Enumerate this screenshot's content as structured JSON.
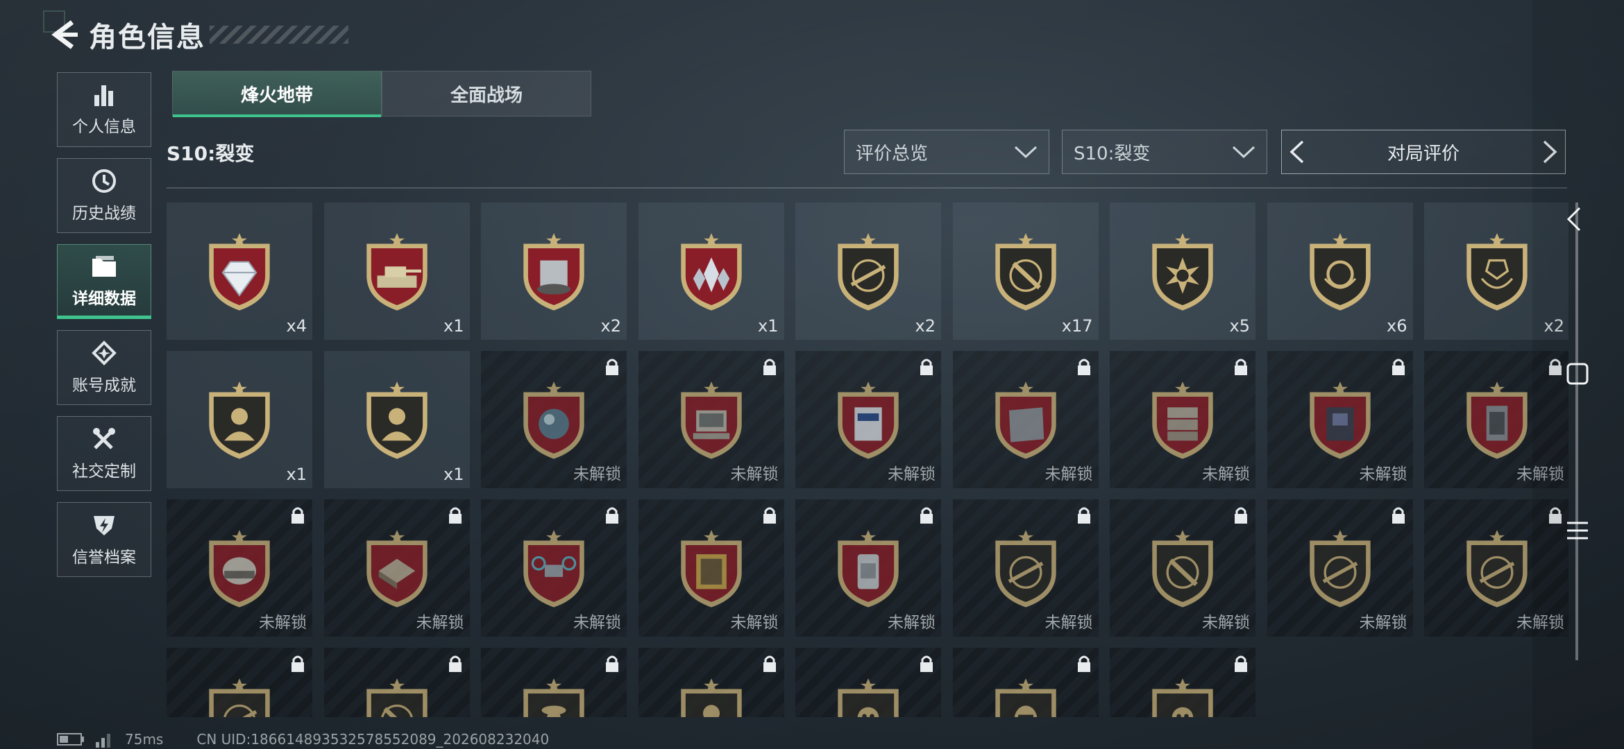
{
  "header": {
    "title": "角色信息"
  },
  "sidebar": {
    "items": [
      {
        "label": "个人信息",
        "icon": "bar-chart-icon"
      },
      {
        "label": "历史战绩",
        "icon": "history-icon"
      },
      {
        "label": "详细数据",
        "icon": "folder-icon",
        "active": true
      },
      {
        "label": "账号成就",
        "icon": "medal-icon"
      },
      {
        "label": "社交定制",
        "icon": "tools-icon"
      },
      {
        "label": "信誉档案",
        "icon": "shield-bolt-icon"
      }
    ]
  },
  "tabs": [
    {
      "label": "烽火地带",
      "active": true
    },
    {
      "label": "全面战场",
      "active": false
    }
  ],
  "season_label": "S10:裂变",
  "filters": {
    "overview": "评价总览",
    "season": "S10:裂变",
    "pager": "对局评价"
  },
  "badges": [
    {
      "emblem": "diamond",
      "count": "x4",
      "locked": false
    },
    {
      "emblem": "tank",
      "count": "x1",
      "locked": false
    },
    {
      "emblem": "robot-vacuum",
      "count": "x2",
      "locked": false
    },
    {
      "emblem": "crystal-cluster",
      "count": "x1",
      "locked": false
    },
    {
      "emblem": "rifle-target",
      "count": "x2",
      "locked": false
    },
    {
      "emblem": "knife-target",
      "count": "x17",
      "locked": false
    },
    {
      "emblem": "burst-skull",
      "count": "x5",
      "locked": false
    },
    {
      "emblem": "laurel-emblem",
      "count": "x6",
      "locked": false
    },
    {
      "emblem": "laurel-shield",
      "count": "x2",
      "locked": false
    },
    {
      "emblem": "operator-bust",
      "count": "x1",
      "locked": false
    },
    {
      "emblem": "operator-bust",
      "count": "x1",
      "locked": false
    },
    {
      "emblem": "orb",
      "count": "未解锁",
      "locked": true
    },
    {
      "emblem": "computer",
      "count": "未解锁",
      "locked": true
    },
    {
      "emblem": "keycard",
      "count": "未解锁",
      "locked": true
    },
    {
      "emblem": "metal-plate",
      "count": "未解锁",
      "locked": true
    },
    {
      "emblem": "server-rack",
      "count": "未解锁",
      "locked": true
    },
    {
      "emblem": "circuit-board",
      "count": "未解锁",
      "locked": true
    },
    {
      "emblem": "lantern-device",
      "count": "未解锁",
      "locked": true
    },
    {
      "emblem": "helmet",
      "count": "未解锁",
      "locked": true
    },
    {
      "emblem": "chessboard",
      "count": "未解锁",
      "locked": true
    },
    {
      "emblem": "drone",
      "count": "未解锁",
      "locked": true
    },
    {
      "emblem": "painting",
      "count": "未解锁",
      "locked": true
    },
    {
      "emblem": "canister",
      "count": "未解锁",
      "locked": true
    },
    {
      "emblem": "rifle-target",
      "count": "未解锁",
      "locked": true
    },
    {
      "emblem": "knife-target",
      "count": "未解锁",
      "locked": true
    },
    {
      "emblem": "rifle-target",
      "count": "未解锁",
      "locked": true
    },
    {
      "emblem": "rifle-target",
      "count": "未解锁",
      "locked": true
    },
    {
      "emblem": "rifle-target",
      "count": "",
      "locked": true
    },
    {
      "emblem": "knife-target",
      "count": "",
      "locked": true
    },
    {
      "emblem": "soldier",
      "count": "",
      "locked": true
    },
    {
      "emblem": "operator-bust",
      "count": "",
      "locked": true
    },
    {
      "emblem": "skull",
      "count": "",
      "locked": true
    },
    {
      "emblem": "mask",
      "count": "",
      "locked": true
    },
    {
      "emblem": "skull",
      "count": "",
      "locked": true
    }
  ],
  "status": {
    "ping": "75ms",
    "uid": "CN UID:18661489353257855​2089_202608232040"
  },
  "colors": {
    "accent": "#3fc48d",
    "shield_red": "#8a1e28",
    "shield_dark": "#2a2a26",
    "gold": "#c9b27a"
  }
}
